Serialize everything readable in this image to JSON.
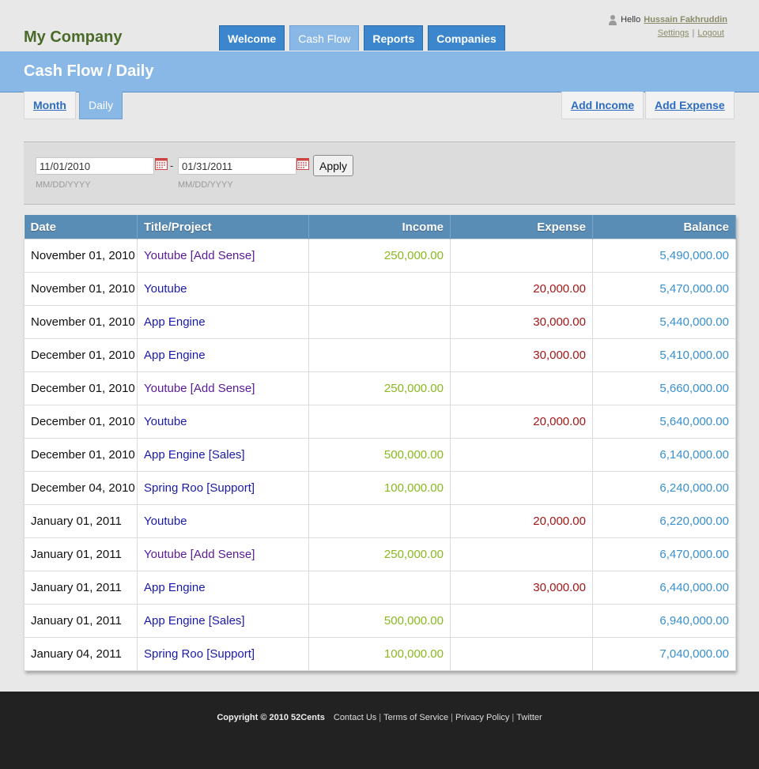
{
  "header": {
    "company": "My Company",
    "nav": [
      "Welcome",
      "Cash Flow",
      "Reports",
      "Companies"
    ],
    "active_nav": 1,
    "user": {
      "hello": "Hello",
      "name": "Hussain Fakhruddin",
      "settings": "Settings",
      "separator": "|",
      "logout": "Logout"
    }
  },
  "page": {
    "title": "Cash Flow / Daily",
    "subtabs": {
      "month": "Month",
      "daily": "Daily"
    },
    "actions": {
      "add_income": "Add Income",
      "add_expense": "Add Expense"
    }
  },
  "filter": {
    "from_value": "11/01/2010",
    "to_value": "01/31/2011",
    "dash": "-",
    "from_hint": "MM/DD/YYYY",
    "to_hint": "MM/DD/YYYY",
    "apply": "Apply"
  },
  "table": {
    "columns": [
      "Date",
      "Title/Project",
      "Income",
      "Expense",
      "Balance"
    ],
    "rows": [
      {
        "date": "November 01, 2010",
        "title": "Youtube [Add Sense]",
        "visited": true,
        "income": "250,000.00",
        "expense": "",
        "balance": "5,490,000.00"
      },
      {
        "date": "November 01, 2010",
        "title": "Youtube",
        "visited": false,
        "income": "",
        "expense": "20,000.00",
        "balance": "5,470,000.00"
      },
      {
        "date": "November 01, 2010",
        "title": "App Engine",
        "visited": false,
        "income": "",
        "expense": "30,000.00",
        "balance": "5,440,000.00"
      },
      {
        "date": "December 01, 2010",
        "title": "App Engine",
        "visited": false,
        "income": "",
        "expense": "30,000.00",
        "balance": "5,410,000.00"
      },
      {
        "date": "December 01, 2010",
        "title": "Youtube [Add Sense]",
        "visited": true,
        "income": "250,000.00",
        "expense": "",
        "balance": "5,660,000.00"
      },
      {
        "date": "December 01, 2010",
        "title": "Youtube",
        "visited": false,
        "income": "",
        "expense": "20,000.00",
        "balance": "5,640,000.00"
      },
      {
        "date": "December 01, 2010",
        "title": "App Engine [Sales]",
        "visited": false,
        "income": "500,000.00",
        "expense": "",
        "balance": "6,140,000.00"
      },
      {
        "date": "December 04, 2010",
        "title": "Spring Roo [Support]",
        "visited": false,
        "income": "100,000.00",
        "expense": "",
        "balance": "6,240,000.00"
      },
      {
        "date": "January 01, 2011",
        "title": "Youtube",
        "visited": false,
        "income": "",
        "expense": "20,000.00",
        "balance": "6,220,000.00"
      },
      {
        "date": "January 01, 2011",
        "title": "Youtube [Add Sense]",
        "visited": true,
        "income": "250,000.00",
        "expense": "",
        "balance": "6,470,000.00"
      },
      {
        "date": "January 01, 2011",
        "title": "App Engine",
        "visited": false,
        "income": "",
        "expense": "30,000.00",
        "balance": "6,440,000.00"
      },
      {
        "date": "January 01, 2011",
        "title": "App Engine [Sales]",
        "visited": false,
        "income": "500,000.00",
        "expense": "",
        "balance": "6,940,000.00"
      },
      {
        "date": "January 04, 2011",
        "title": "Spring Roo [Support]",
        "visited": false,
        "income": "100,000.00",
        "expense": "",
        "balance": "7,040,000.00"
      }
    ]
  },
  "footer": {
    "copyright": "Copyright © 2010 52Cents",
    "links": [
      "Contact Us",
      "Terms of Service",
      "Privacy Policy",
      "Twitter"
    ],
    "separator": "|"
  },
  "colors": {
    "nav_tab": "#3b86cc",
    "banner": "#8ab8e6",
    "table_header": "#5a8db6",
    "income": "#8ab820",
    "expense": "#a01818",
    "balance": "#3a8fcc"
  }
}
